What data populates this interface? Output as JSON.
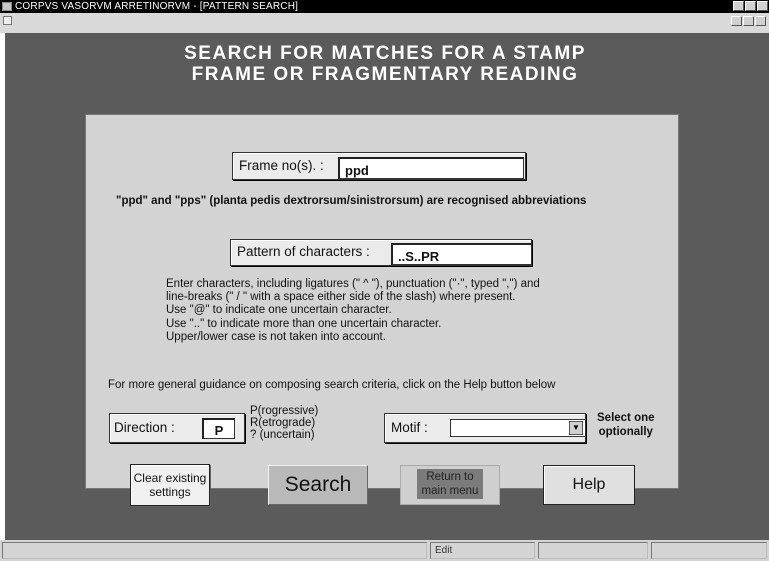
{
  "window": {
    "title": "CORPVS VASORVM ARRETINORVM - [PATTERN SEARCH]"
  },
  "heading": {
    "line1": "SEARCH FOR MATCHES FOR A STAMP",
    "line2": "FRAME OR FRAGMENTARY READING"
  },
  "frame": {
    "label": "Frame no(s). :",
    "value": "ppd",
    "note": "\"ppd\" and \"pps\" (planta pedis dextrorsum/sinistrorsum) are recognised abbreviations"
  },
  "pattern": {
    "label": "Pattern of characters :",
    "value": "..S..PR",
    "instructions": [
      "Enter characters, including ligatures (\" ^ \"), punctuation (\"·\", typed \",\") and",
      "line-breaks (\" / \" with a space either side of the slash) where present.",
      "Use \"@\" to indicate one uncertain character.",
      "Use \"..\" to indicate more than one uncertain  character.",
      "Upper/lower case is not taken into account."
    ]
  },
  "guidance": "For more general guidance on composing search criteria, click on the Help button below",
  "direction": {
    "label": "Direction :",
    "value": "P",
    "options": [
      "P(rogressive)",
      "R(etrograde)",
      "? (uncertain)"
    ]
  },
  "motif": {
    "label": "Motif :",
    "value": "",
    "hint_line1": "Select one",
    "hint_line2": "optionally"
  },
  "buttons": {
    "clear_line1": "Clear existing",
    "clear_line2": "settings",
    "search": "Search",
    "return_line1": "Return to",
    "return_line2": "main menu",
    "help": "Help"
  },
  "status": {
    "mode": "Edit"
  },
  "colors": {
    "workspace": "#5b5b5b",
    "panel": "#d3d3d3",
    "titlebar": "#000000"
  }
}
